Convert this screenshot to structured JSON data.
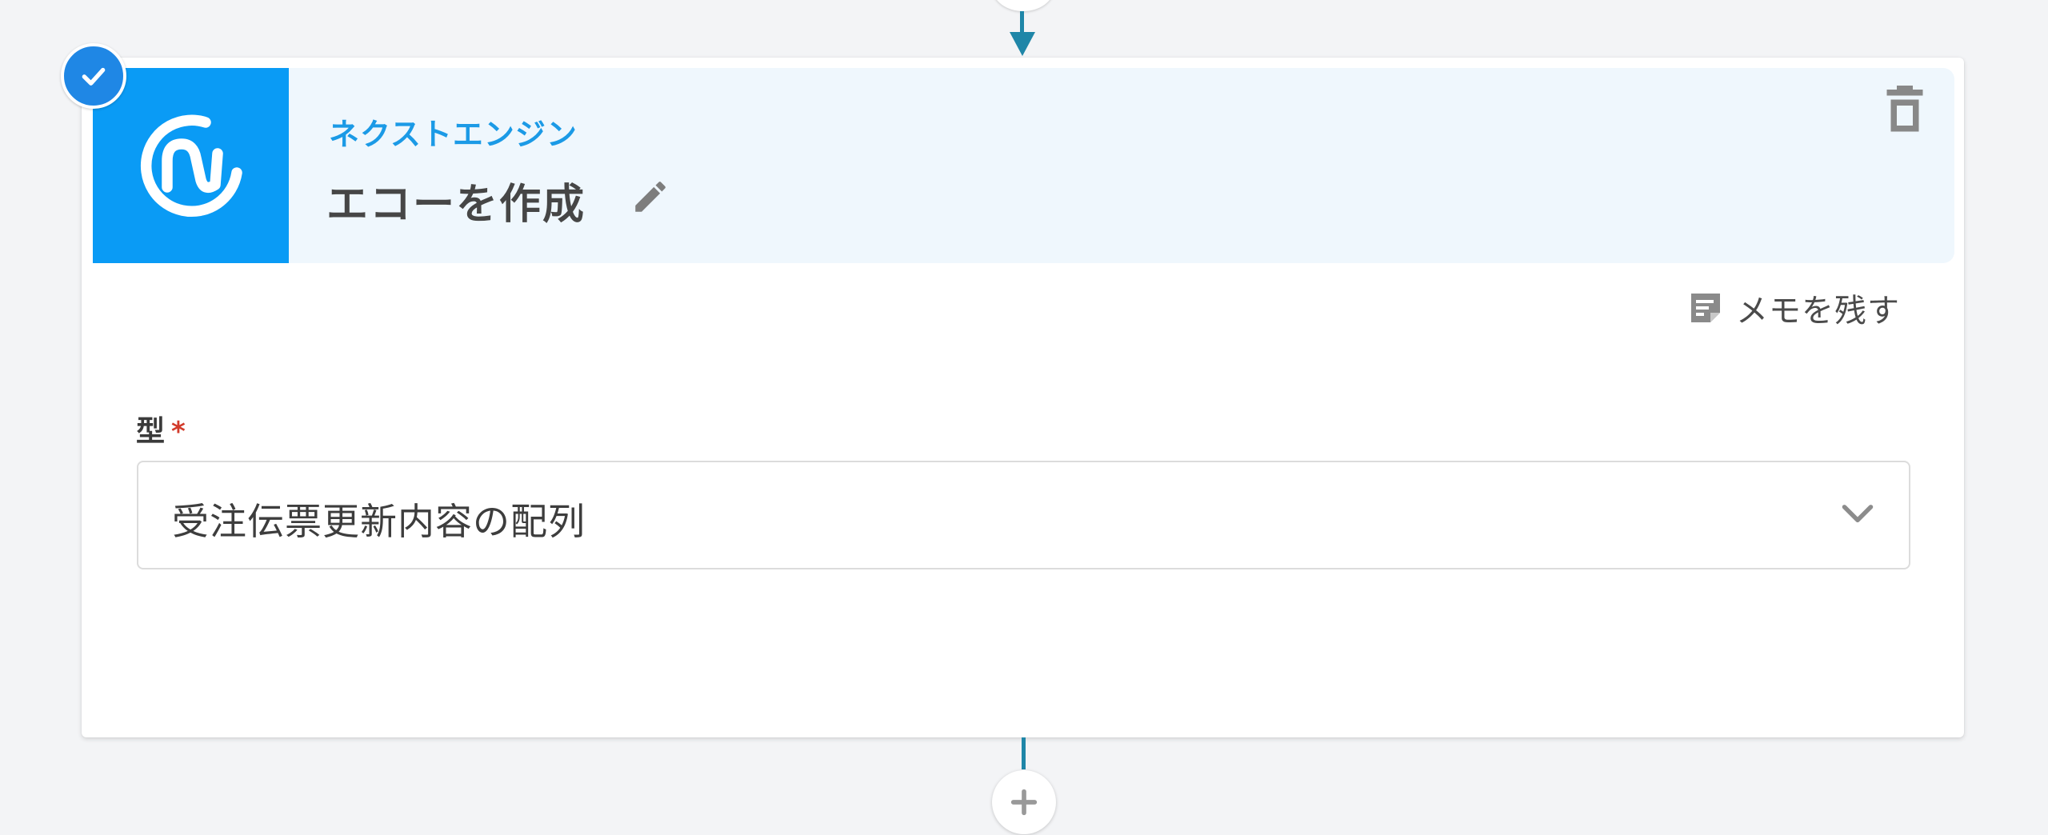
{
  "flow_step": {
    "app_name": "ネクストエンジン",
    "action_title": "エコーを作成",
    "memo_label": "メモを残す",
    "completed": true
  },
  "form": {
    "type_field": {
      "label": "型",
      "required_mark": "*",
      "selected_value": "受注伝票更新内容の配列"
    }
  },
  "icons": {
    "check": "check-icon",
    "logo": "next-engine-logo",
    "edit": "pencil-icon",
    "delete": "trash-icon",
    "memo": "memo-icon",
    "dropdown": "chevron-down-icon",
    "add": "plus-icon"
  },
  "colors": {
    "accent": "#0a9bf5",
    "app_name": "#1b9ae6",
    "header_bg": "#eff7fd",
    "connector": "#1f86a8",
    "required": "#d23b2b",
    "page_bg": "#f3f4f6"
  }
}
